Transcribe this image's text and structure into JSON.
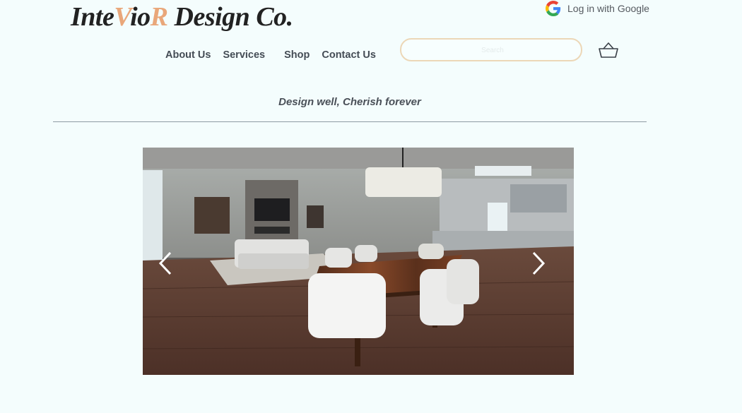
{
  "brand": {
    "logo_part1": "Inte",
    "logo_v": "V",
    "logo_part2": "io",
    "logo_r": "R",
    "logo_part3": " Design Co.",
    "accent_color": "#e9a77a"
  },
  "header": {
    "login_label": "Log in with Google",
    "login_icon": "google-icon",
    "search_placeholder": "Search",
    "cart_icon": "basket-icon"
  },
  "nav": {
    "items": [
      {
        "label": "About Us"
      },
      {
        "label": "Services"
      },
      {
        "label": "Shop"
      },
      {
        "label": "Contact Us"
      }
    ]
  },
  "tagline": "Design well, Cherish forever",
  "slideshow": {
    "image_description": "interior dining and kitchen render",
    "prev_icon": "chevron-left-icon",
    "next_icon": "chevron-right-icon"
  },
  "colors": {
    "background": "#f4fdfd",
    "search_border": "#ecd7b7",
    "text": "#444c55"
  }
}
